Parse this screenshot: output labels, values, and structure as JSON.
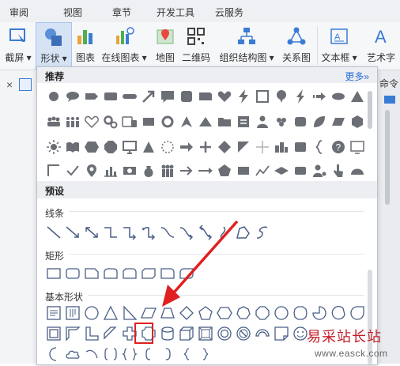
{
  "menu_tabs": [
    "审阅",
    "视图",
    "章节",
    "开发工具",
    "云服务"
  ],
  "ribbon": {
    "buttons": [
      {
        "label": "截屏 ▾",
        "icon": "screenshot-icon"
      },
      {
        "label": "形状 ▾",
        "icon": "shapes-icon",
        "active": true
      },
      {
        "label": "图表",
        "icon": "chart-icon"
      },
      {
        "label": "在线图表 ▾",
        "icon": "online-chart-icon"
      },
      {
        "label": "地图",
        "icon": "map-icon"
      },
      {
        "label": "二维码",
        "icon": "qr-code-icon"
      },
      {
        "label": "组织结构图 ▾",
        "icon": "org-chart-icon"
      },
      {
        "label": "关系图",
        "icon": "relation-icon"
      },
      {
        "label": "文本框 ▾",
        "icon": "textbox-icon"
      },
      {
        "label": "艺术字",
        "icon": "wordart-icon"
      }
    ]
  },
  "side_fragment": "命令",
  "left_close": "×",
  "panel": {
    "recommend_title": "推荐",
    "more_label": "更多»",
    "preset_title": "预设",
    "subsections": [
      "线条",
      "矩形",
      "基本形状"
    ]
  },
  "watermark": {
    "text": "易采站长站",
    "url": "www.easck.com"
  },
  "colors": {
    "accent": "#2b6fd6",
    "highlight": "#e02020",
    "shape_gray": "#6b6f75",
    "outline_blue": "#4a5f86"
  }
}
